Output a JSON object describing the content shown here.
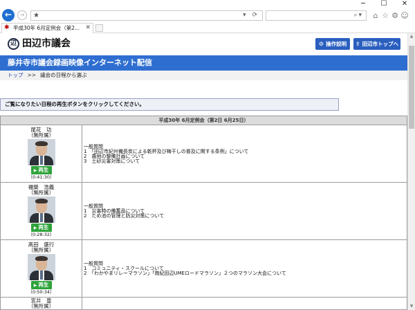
{
  "browser": {
    "win_min": "─",
    "win_max": "☐",
    "win_close": "✕",
    "back_icon": "←",
    "forward_icon": "→",
    "address_star": "★",
    "address_tools": "▾ ⟳",
    "search_tools": "⌕▾",
    "nav_icons": [
      "⌂",
      "☆",
      "⚙",
      "☺"
    ],
    "tab_title": "平成30年 6月定例会（第2...",
    "tab_close": "✕"
  },
  "site": {
    "logo_glyph": "辺",
    "title": "田辺市議会",
    "manual_button": "操作説明",
    "manual_icon": "⚙",
    "top_button": "田辺市トップへ",
    "top_icon": "⇪",
    "banner": "藤井寺市議会録画映像インターネット配信",
    "breadcrumb_home": "トップ",
    "breadcrumb_sep": ">>",
    "breadcrumb_current": "議会の日程から選ぶ",
    "instruction": "ご覧になりたい日程の再生ボタンをクリックしてください。"
  },
  "schedule": {
    "header": "平成30年 6月定例会（第2日 6月25日）",
    "play_label": "再生",
    "members": [
      {
        "name": "尾花　功",
        "party": "（無所属）",
        "duration": "（0:41:30）",
        "category": "一般質問",
        "items": [
          "1　「田辺市紀州備長炭による乾杯及び梅干しの普及に関する条例」について",
          "2　農地の整備計画について",
          "3　土砂災害対策について"
        ]
      },
      {
        "name": "福榮　浩義",
        "party": "（無所属）",
        "duration": "（0:28:32）",
        "category": "一般質問",
        "items": [
          "1　災害時の備蓄品について",
          "2　ため池の管理と防災対策について"
        ]
      },
      {
        "name": "髙田　盛行",
        "party": "（無所属）",
        "duration": "（0:50:34）",
        "category": "一般質問",
        "items": [
          "1　コミュニティ・スクールについて",
          "2　「わかやまリレーマラソン」「南紀田辺UMEロードマラソン」２つのマラソン大会について"
        ]
      }
    ],
    "partial_member": {
      "name": "宮井　豊",
      "party": "（無所属）"
    }
  }
}
